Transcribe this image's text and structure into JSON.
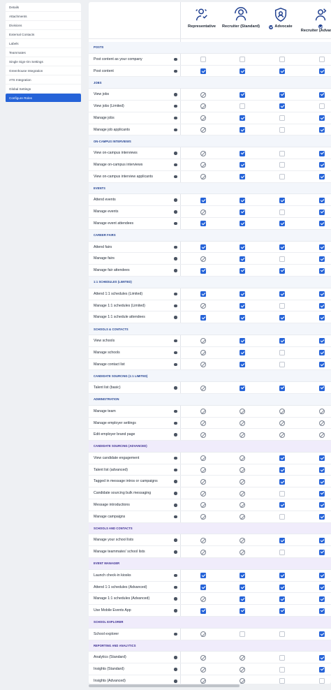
{
  "sidebar": {
    "items": [
      "Details",
      "Attachments",
      "Divisions",
      "External Contacts",
      "Labels",
      "Teammates",
      "Single Sign-On Settings",
      "Greenhouse Integration",
      "ATS Integration",
      "Global Settings",
      "Configure Roles"
    ],
    "active_index": 10
  },
  "columns": [
    {
      "label": "Representative",
      "icon": "user-badge-icon",
      "badge": false
    },
    {
      "label": "Recruiter (Standard)",
      "icon": "recruiter-icon",
      "badge": false
    },
    {
      "label": "Advocate",
      "icon": "shield-user-icon",
      "badge": true
    },
    {
      "label": "Recruiter (Advanced)",
      "icon": "recruiter-advanced-icon",
      "badge": true
    }
  ],
  "legend": {
    "on": "checked",
    "off": "unchecked",
    "na": "not-available"
  },
  "sections": [
    {
      "title": "POSTS",
      "style": "blue",
      "rows": [
        {
          "label": "Post content as your company",
          "v": [
            "off",
            "off",
            "off",
            "off"
          ]
        },
        {
          "label": "Post content",
          "v": [
            "on",
            "on",
            "on",
            "on"
          ]
        }
      ]
    },
    {
      "title": "JOBS",
      "style": "blue",
      "rows": [
        {
          "label": "View jobs",
          "v": [
            "na",
            "on",
            "on",
            "on"
          ]
        },
        {
          "label": "View jobs (Limited)",
          "v": [
            "na",
            "off",
            "on",
            "off"
          ]
        },
        {
          "label": "Manage jobs",
          "v": [
            "na",
            "on",
            "off",
            "on"
          ]
        },
        {
          "label": "Manage job applicants",
          "v": [
            "na",
            "on",
            "off",
            "on"
          ]
        }
      ]
    },
    {
      "title": "ON-CAMPUS INTERVIEWS",
      "style": "blue",
      "rows": [
        {
          "label": "View on-campus interviews",
          "v": [
            "na",
            "on",
            "off",
            "on"
          ]
        },
        {
          "label": "Manage on-campus interviews",
          "v": [
            "na",
            "on",
            "off",
            "on"
          ]
        },
        {
          "label": "View on-campus interview applicants",
          "v": [
            "na",
            "on",
            "off",
            "on"
          ]
        }
      ]
    },
    {
      "title": "EVENTS",
      "style": "blue",
      "rows": [
        {
          "label": "Attend events",
          "v": [
            "on",
            "on",
            "on",
            "on"
          ]
        },
        {
          "label": "Manage events",
          "v": [
            "na",
            "on",
            "off",
            "on"
          ]
        },
        {
          "label": "Manage event attendees",
          "v": [
            "on",
            "on",
            "on",
            "on"
          ]
        }
      ]
    },
    {
      "title": "CAREER FAIRS",
      "style": "blue",
      "rows": [
        {
          "label": "Attend fairs",
          "v": [
            "on",
            "on",
            "on",
            "on"
          ]
        },
        {
          "label": "Manage fairs",
          "v": [
            "na",
            "on",
            "off",
            "on"
          ]
        },
        {
          "label": "Manage fair attendees",
          "v": [
            "on",
            "on",
            "on",
            "on"
          ]
        }
      ]
    },
    {
      "title": "1:1 SCHEDULES (LIMITED)",
      "style": "blue",
      "rows": [
        {
          "label": "Attend 1:1 schedules (Limited)",
          "v": [
            "on",
            "on",
            "on",
            "on"
          ]
        },
        {
          "label": "Manage 1:1 schedules (Limited)",
          "v": [
            "na",
            "on",
            "off",
            "on"
          ]
        },
        {
          "label": "Manage 1:1 schedule attendees",
          "v": [
            "on",
            "on",
            "on",
            "on"
          ]
        }
      ]
    },
    {
      "title": "SCHOOLS & CONTACTS",
      "style": "blue",
      "rows": [
        {
          "label": "View schools",
          "v": [
            "na",
            "on",
            "on",
            "on"
          ]
        },
        {
          "label": "Manage schools",
          "v": [
            "na",
            "on",
            "off",
            "on"
          ]
        },
        {
          "label": "Manage contact list",
          "v": [
            "na",
            "on",
            "off",
            "on"
          ]
        }
      ]
    },
    {
      "title": "CANDIDATE SOURCING (1:1 LIMITED)",
      "style": "blue",
      "rows": [
        {
          "label": "Talent list (basic)",
          "v": [
            "na",
            "on",
            "on",
            "on"
          ]
        }
      ]
    },
    {
      "title": "ADMINISTRATION",
      "style": "blue",
      "rows": [
        {
          "label": "Manage team",
          "v": [
            "na",
            "na",
            "na",
            "na"
          ]
        },
        {
          "label": "Manage employer settings",
          "v": [
            "na",
            "na",
            "na",
            "na"
          ]
        },
        {
          "label": "Edit employer brand page",
          "v": [
            "na",
            "na",
            "na",
            "na"
          ]
        }
      ]
    },
    {
      "title": "CANDIDATE SOURCING (ADVANCED)",
      "style": "purple",
      "rows": [
        {
          "label": "View candidate engagement",
          "v": [
            "na",
            "na",
            "on",
            "on"
          ]
        },
        {
          "label": "Talent list (advanced)",
          "v": [
            "na",
            "na",
            "on",
            "on"
          ]
        },
        {
          "label": "Tagged in message intros or campaigns",
          "v": [
            "na",
            "na",
            "on",
            "on"
          ]
        },
        {
          "label": "Candidate sourcing bulk messaging",
          "v": [
            "na",
            "na",
            "off",
            "on"
          ]
        },
        {
          "label": "Message introductions",
          "v": [
            "na",
            "na",
            "on",
            "on"
          ]
        },
        {
          "label": "Manage campaigns",
          "v": [
            "na",
            "na",
            "off",
            "on"
          ]
        }
      ]
    },
    {
      "title": "SCHOOLS AND CONTACTS",
      "style": "purple",
      "rows": [
        {
          "label": "Manage your school lists",
          "v": [
            "na",
            "na",
            "on",
            "on"
          ]
        },
        {
          "label": "Manage teammates' school lists",
          "v": [
            "na",
            "na",
            "off",
            "on"
          ]
        }
      ]
    },
    {
      "title": "EVENT MANAGER",
      "style": "purple",
      "rows": [
        {
          "label": "Launch check-in kiosks",
          "v": [
            "on",
            "on",
            "on",
            "on"
          ]
        },
        {
          "label": "Attend 1:1 schedules (Advanced)",
          "v": [
            "on",
            "on",
            "on",
            "on"
          ]
        },
        {
          "label": "Manage 1:1 schedules (Advanced)",
          "v": [
            "na",
            "on",
            "on",
            "on"
          ]
        },
        {
          "label": "Use Mobile Events App",
          "v": [
            "on",
            "on",
            "on",
            "on"
          ]
        }
      ]
    },
    {
      "title": "SCHOOL EXPLORER",
      "style": "purple",
      "rows": [
        {
          "label": "School explorer",
          "v": [
            "na",
            "off",
            "off",
            "on"
          ]
        }
      ]
    },
    {
      "title": "REPORTING AND ANALYTICS",
      "style": "purple",
      "rows": [
        {
          "label": "Analytics (Standard)",
          "v": [
            "na",
            "na",
            "off",
            "on"
          ]
        },
        {
          "label": "Insights (Standard)",
          "v": [
            "na",
            "na",
            "off",
            "on"
          ]
        },
        {
          "label": "Insights (Advanced)",
          "v": [
            "na",
            "na",
            "off",
            "off"
          ]
        }
      ]
    }
  ]
}
